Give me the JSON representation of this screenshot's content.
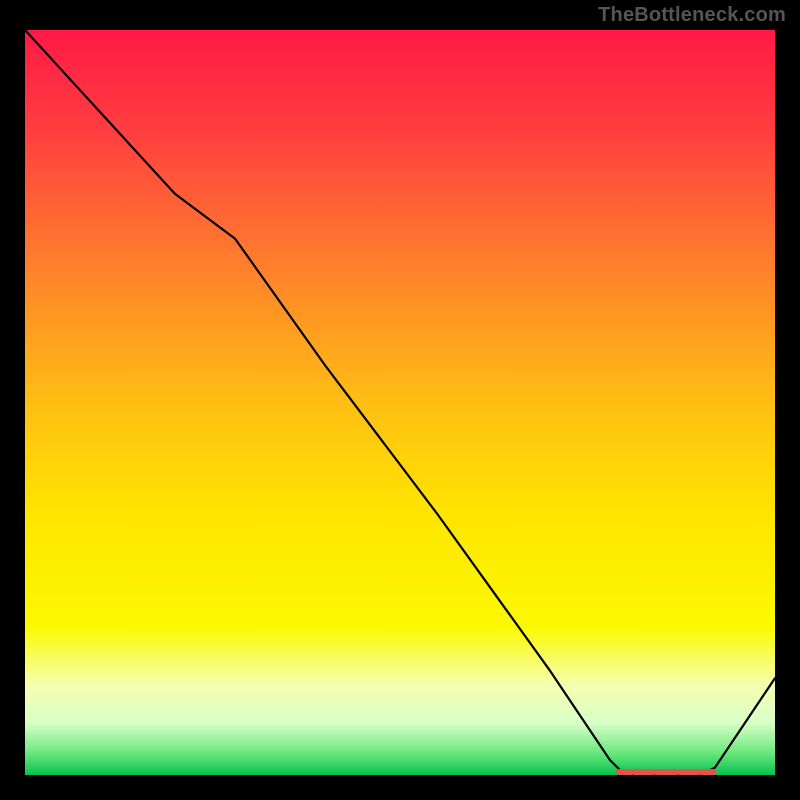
{
  "branding": {
    "credit": "TheBottleneck.com"
  },
  "gradient": {
    "stops": [
      {
        "offset": 0.0,
        "color": "#ff1a46"
      },
      {
        "offset": 0.14,
        "color": "#ff3f3f"
      },
      {
        "offset": 0.3,
        "color": "#ff7a2e"
      },
      {
        "offset": 0.5,
        "color": "#ffbe14"
      },
      {
        "offset": 0.65,
        "color": "#ffe500"
      },
      {
        "offset": 0.8,
        "color": "#fbf900"
      },
      {
        "offset": 0.88,
        "color": "#f5ffb0"
      },
      {
        "offset": 0.93,
        "color": "#d8ffc8"
      },
      {
        "offset": 0.97,
        "color": "#6ce87e"
      },
      {
        "offset": 1.0,
        "color": "#06c24e"
      }
    ]
  },
  "chart_data": {
    "type": "line",
    "title": "",
    "xlabel": "",
    "ylabel": "",
    "xlim": [
      0,
      100
    ],
    "ylim": [
      0,
      100
    ],
    "series": [
      {
        "name": "curve",
        "x": [
          0,
          10,
          20,
          28,
          40,
          55,
          70,
          78,
          80,
          82,
          84,
          86,
          88,
          90,
          92,
          100
        ],
        "y": [
          100,
          89,
          78,
          72,
          55,
          35,
          14,
          2,
          0,
          0,
          0,
          0,
          0,
          0,
          1,
          13
        ]
      }
    ],
    "markers": {
      "name": "bottom-cluster",
      "x": [
        80,
        82,
        83,
        85,
        86,
        88,
        89,
        91
      ],
      "y": [
        0,
        0,
        0,
        0,
        0,
        0,
        0,
        0
      ]
    }
  }
}
